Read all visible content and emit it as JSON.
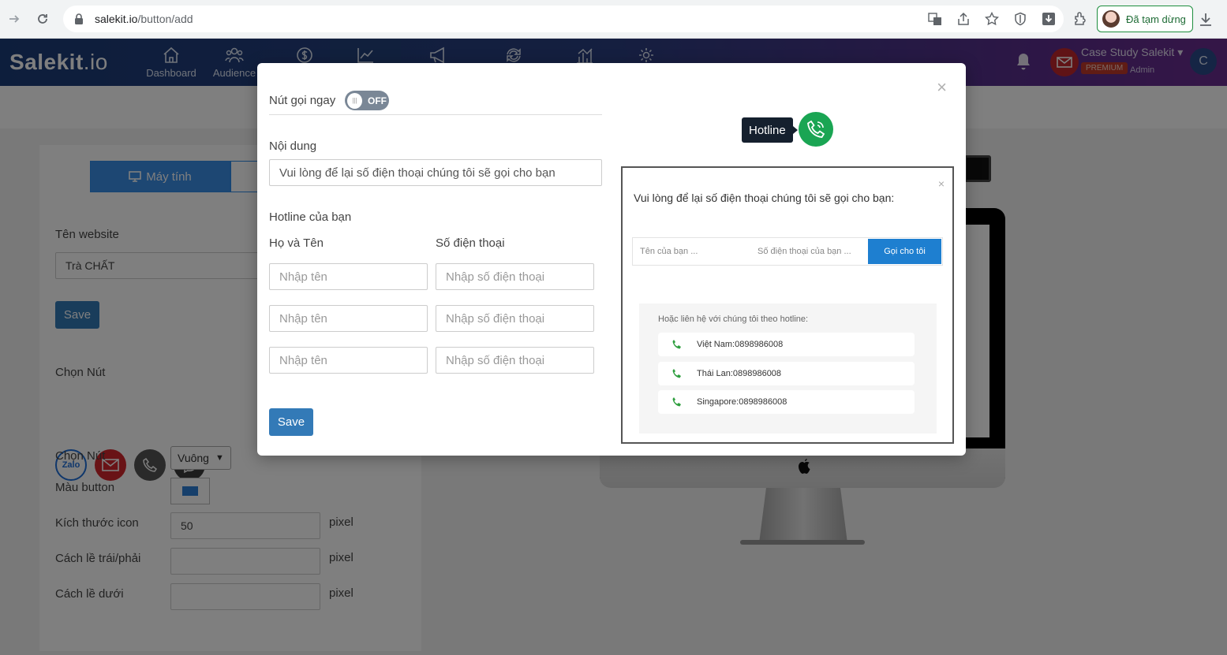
{
  "browser": {
    "url_host": "salekit.io",
    "url_path": "/button/add",
    "profile_label": "Đã tạm dừng"
  },
  "header": {
    "logo_main": "Salekit",
    "logo_suffix": ".io",
    "nav": [
      {
        "label": "Dashboard",
        "icon": "home-icon"
      },
      {
        "label": "Audience",
        "icon": "users-icon"
      },
      {
        "label": "",
        "icon": "dollar-icon"
      },
      {
        "label": "",
        "icon": "chart-icon"
      },
      {
        "label": "",
        "icon": "megaphone-icon"
      },
      {
        "label": "",
        "icon": "sync-icon"
      },
      {
        "label": "",
        "icon": "bar-chart-icon"
      },
      {
        "label": "",
        "icon": "gear-icon"
      }
    ],
    "account_name": "Case Study Salekit",
    "premium_badge": "PREMIUM",
    "role": "Admin",
    "avatar_letter": "C"
  },
  "panel": {
    "device_tab_label": "Máy tính",
    "website_label": "Tên website",
    "website_value": "Trà CHẤT",
    "save_label": "Save",
    "choose_button_label": "Chọn Nút",
    "social_buttons": [
      {
        "name": "zalo",
        "label": "Zalo",
        "color": "#1f6ed8"
      },
      {
        "name": "mail",
        "label": "",
        "color": "#d3262d"
      },
      {
        "name": "phone",
        "label": "",
        "color": "#555555"
      },
      {
        "name": "messenger",
        "label": "",
        "color": "#3a3a3a"
      }
    ],
    "shape_label": "Chọn Nút",
    "shape_value": "Vuông",
    "color_label": "Màu button",
    "color_value": "#2d7ed7",
    "icon_size_label": "Kích thước icon",
    "icon_size_value": "50",
    "margin_lr_label": "Cách lề trái/phải",
    "margin_bottom_label": "Cách lề dưới",
    "unit": "pixel"
  },
  "modal": {
    "call_now_label": "Nút gọi ngay",
    "toggle_state": "OFF",
    "content_label": "Nội dung",
    "content_value": "Vui lòng để lại số điện thoại chúng tôi sẽ gọi cho bạn",
    "hotline_label": "Hotline của bạn",
    "name_col": "Họ và Tên",
    "phone_col": "Số điện thoại",
    "name_placeholder": "Nhập tên",
    "phone_placeholder": "Nhập số điện thoại",
    "save_label": "Save",
    "close_glyph": "×",
    "hotline_tag": "Hotline",
    "preview": {
      "close_glyph": "×",
      "title": "Vui lòng để lại số điện thoại chúng tôi sẽ gọi cho bạn:",
      "name_placeholder": "Tên của bạn ...",
      "phone_placeholder": "Số điện thoại của bạn ...",
      "call_button": "Gọi cho tôi",
      "alt_header": "Hoặc liên hệ với chúng tôi theo hotline:",
      "hotlines": [
        "Việt Nam:0898986008",
        "Thái Lan:0898986008",
        "Singapore:0898986008"
      ]
    }
  }
}
